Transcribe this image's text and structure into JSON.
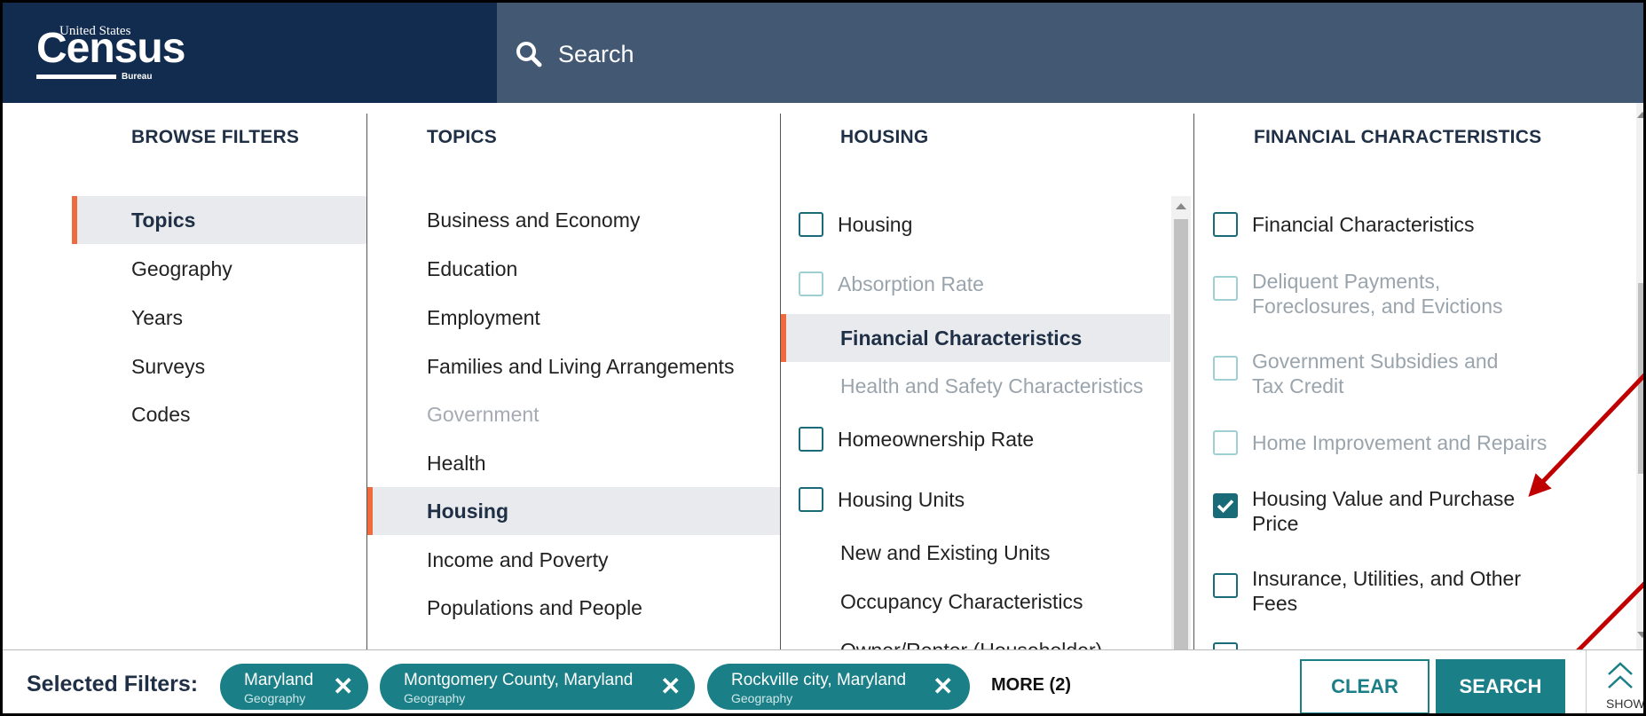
{
  "header": {
    "logo": {
      "line1": "United States",
      "line2": "Census",
      "line3": "Bureau"
    },
    "search_label": "Search"
  },
  "browse_filters": {
    "heading": "BROWSE FILTERS",
    "items": [
      {
        "label": "Topics",
        "active": true
      },
      {
        "label": "Geography"
      },
      {
        "label": "Years"
      },
      {
        "label": "Surveys"
      },
      {
        "label": "Codes"
      }
    ]
  },
  "topics": {
    "heading": "TOPICS",
    "items": [
      {
        "label": "Business and Economy"
      },
      {
        "label": "Education"
      },
      {
        "label": "Employment"
      },
      {
        "label": "Families and Living Arrangements"
      },
      {
        "label": "Government",
        "disabled": true
      },
      {
        "label": "Health"
      },
      {
        "label": "Housing",
        "active": true
      },
      {
        "label": "Income and Poverty"
      },
      {
        "label": "Populations and People"
      }
    ]
  },
  "housing": {
    "heading": "HOUSING",
    "items": [
      {
        "label": "Housing"
      },
      {
        "label": "Absorption Rate"
      },
      {
        "label": "Financial Characteristics"
      },
      {
        "label": "Health and Safety Characteristics"
      },
      {
        "label": "Homeownership Rate"
      },
      {
        "label": "Housing Units"
      },
      {
        "label": "New and Existing Units"
      },
      {
        "label": "Occupancy Characteristics"
      },
      {
        "label": "Owner/Renter (Householder)"
      }
    ]
  },
  "financial": {
    "heading": "FINANCIAL CHARACTERISTICS",
    "items": [
      {
        "label": "Financial Characteristics"
      },
      {
        "label": "Deliquent Payments, Foreclosures, and Evictions"
      },
      {
        "label": "Government Subsidies and Tax Credit"
      },
      {
        "label": "Home Improvement and Repairs"
      },
      {
        "label": "Housing Value and Purchase Price",
        "checked": true
      },
      {
        "label": "Insurance, Utilities, and Other Fees"
      }
    ]
  },
  "selected": {
    "label": "Selected Filters:",
    "chips": [
      {
        "name": "Maryland",
        "type": "Geography"
      },
      {
        "name": "Montgomery County, Maryland",
        "type": "Geography"
      },
      {
        "name": "Rockville city, Maryland",
        "type": "Geography"
      }
    ],
    "more": "MORE (2)"
  },
  "buttons": {
    "clear": "CLEAR",
    "search": "SEARCH",
    "show": "SHOW"
  },
  "colors": {
    "header_bg": "#425873",
    "logo_bg": "#122c4f",
    "accent": "#ef6a3c",
    "teal": "#1a7f86",
    "annotation_arrow": "#c00000"
  }
}
